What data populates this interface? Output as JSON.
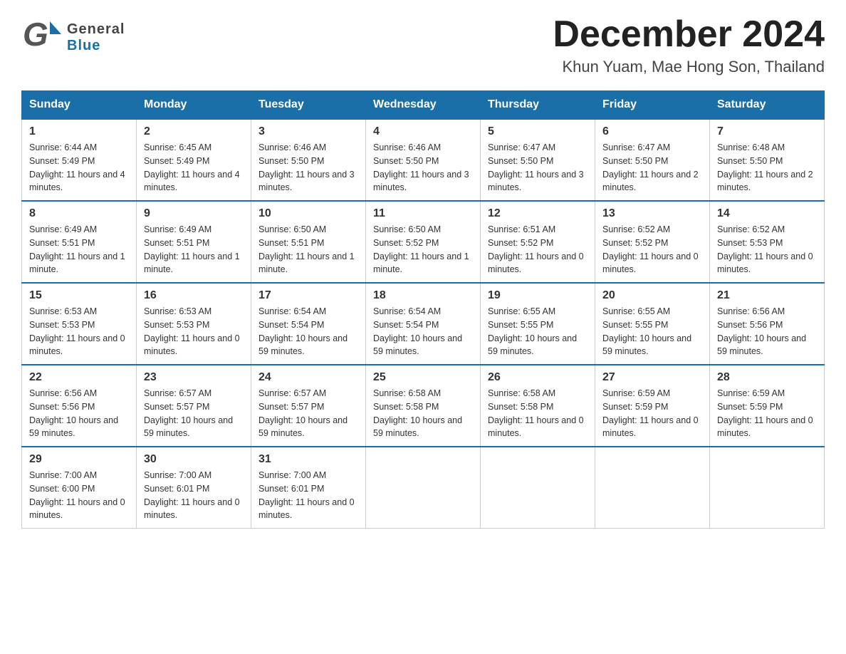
{
  "header": {
    "logo_general": "General",
    "logo_blue": "Blue",
    "month_title": "December 2024",
    "location": "Khun Yuam, Mae Hong Son, Thailand"
  },
  "calendar": {
    "days_of_week": [
      "Sunday",
      "Monday",
      "Tuesday",
      "Wednesday",
      "Thursday",
      "Friday",
      "Saturday"
    ],
    "weeks": [
      [
        {
          "date": "1",
          "sunrise": "6:44 AM",
          "sunset": "5:49 PM",
          "daylight": "11 hours and 4 minutes."
        },
        {
          "date": "2",
          "sunrise": "6:45 AM",
          "sunset": "5:49 PM",
          "daylight": "11 hours and 4 minutes."
        },
        {
          "date": "3",
          "sunrise": "6:46 AM",
          "sunset": "5:50 PM",
          "daylight": "11 hours and 3 minutes."
        },
        {
          "date": "4",
          "sunrise": "6:46 AM",
          "sunset": "5:50 PM",
          "daylight": "11 hours and 3 minutes."
        },
        {
          "date": "5",
          "sunrise": "6:47 AM",
          "sunset": "5:50 PM",
          "daylight": "11 hours and 3 minutes."
        },
        {
          "date": "6",
          "sunrise": "6:47 AM",
          "sunset": "5:50 PM",
          "daylight": "11 hours and 2 minutes."
        },
        {
          "date": "7",
          "sunrise": "6:48 AM",
          "sunset": "5:50 PM",
          "daylight": "11 hours and 2 minutes."
        }
      ],
      [
        {
          "date": "8",
          "sunrise": "6:49 AM",
          "sunset": "5:51 PM",
          "daylight": "11 hours and 1 minute."
        },
        {
          "date": "9",
          "sunrise": "6:49 AM",
          "sunset": "5:51 PM",
          "daylight": "11 hours and 1 minute."
        },
        {
          "date": "10",
          "sunrise": "6:50 AM",
          "sunset": "5:51 PM",
          "daylight": "11 hours and 1 minute."
        },
        {
          "date": "11",
          "sunrise": "6:50 AM",
          "sunset": "5:52 PM",
          "daylight": "11 hours and 1 minute."
        },
        {
          "date": "12",
          "sunrise": "6:51 AM",
          "sunset": "5:52 PM",
          "daylight": "11 hours and 0 minutes."
        },
        {
          "date": "13",
          "sunrise": "6:52 AM",
          "sunset": "5:52 PM",
          "daylight": "11 hours and 0 minutes."
        },
        {
          "date": "14",
          "sunrise": "6:52 AM",
          "sunset": "5:53 PM",
          "daylight": "11 hours and 0 minutes."
        }
      ],
      [
        {
          "date": "15",
          "sunrise": "6:53 AM",
          "sunset": "5:53 PM",
          "daylight": "11 hours and 0 minutes."
        },
        {
          "date": "16",
          "sunrise": "6:53 AM",
          "sunset": "5:53 PM",
          "daylight": "11 hours and 0 minutes."
        },
        {
          "date": "17",
          "sunrise": "6:54 AM",
          "sunset": "5:54 PM",
          "daylight": "10 hours and 59 minutes."
        },
        {
          "date": "18",
          "sunrise": "6:54 AM",
          "sunset": "5:54 PM",
          "daylight": "10 hours and 59 minutes."
        },
        {
          "date": "19",
          "sunrise": "6:55 AM",
          "sunset": "5:55 PM",
          "daylight": "10 hours and 59 minutes."
        },
        {
          "date": "20",
          "sunrise": "6:55 AM",
          "sunset": "5:55 PM",
          "daylight": "10 hours and 59 minutes."
        },
        {
          "date": "21",
          "sunrise": "6:56 AM",
          "sunset": "5:56 PM",
          "daylight": "10 hours and 59 minutes."
        }
      ],
      [
        {
          "date": "22",
          "sunrise": "6:56 AM",
          "sunset": "5:56 PM",
          "daylight": "10 hours and 59 minutes."
        },
        {
          "date": "23",
          "sunrise": "6:57 AM",
          "sunset": "5:57 PM",
          "daylight": "10 hours and 59 minutes."
        },
        {
          "date": "24",
          "sunrise": "6:57 AM",
          "sunset": "5:57 PM",
          "daylight": "10 hours and 59 minutes."
        },
        {
          "date": "25",
          "sunrise": "6:58 AM",
          "sunset": "5:58 PM",
          "daylight": "10 hours and 59 minutes."
        },
        {
          "date": "26",
          "sunrise": "6:58 AM",
          "sunset": "5:58 PM",
          "daylight": "11 hours and 0 minutes."
        },
        {
          "date": "27",
          "sunrise": "6:59 AM",
          "sunset": "5:59 PM",
          "daylight": "11 hours and 0 minutes."
        },
        {
          "date": "28",
          "sunrise": "6:59 AM",
          "sunset": "5:59 PM",
          "daylight": "11 hours and 0 minutes."
        }
      ],
      [
        {
          "date": "29",
          "sunrise": "7:00 AM",
          "sunset": "6:00 PM",
          "daylight": "11 hours and 0 minutes."
        },
        {
          "date": "30",
          "sunrise": "7:00 AM",
          "sunset": "6:01 PM",
          "daylight": "11 hours and 0 minutes."
        },
        {
          "date": "31",
          "sunrise": "7:00 AM",
          "sunset": "6:01 PM",
          "daylight": "11 hours and 0 minutes."
        },
        null,
        null,
        null,
        null
      ]
    ]
  }
}
